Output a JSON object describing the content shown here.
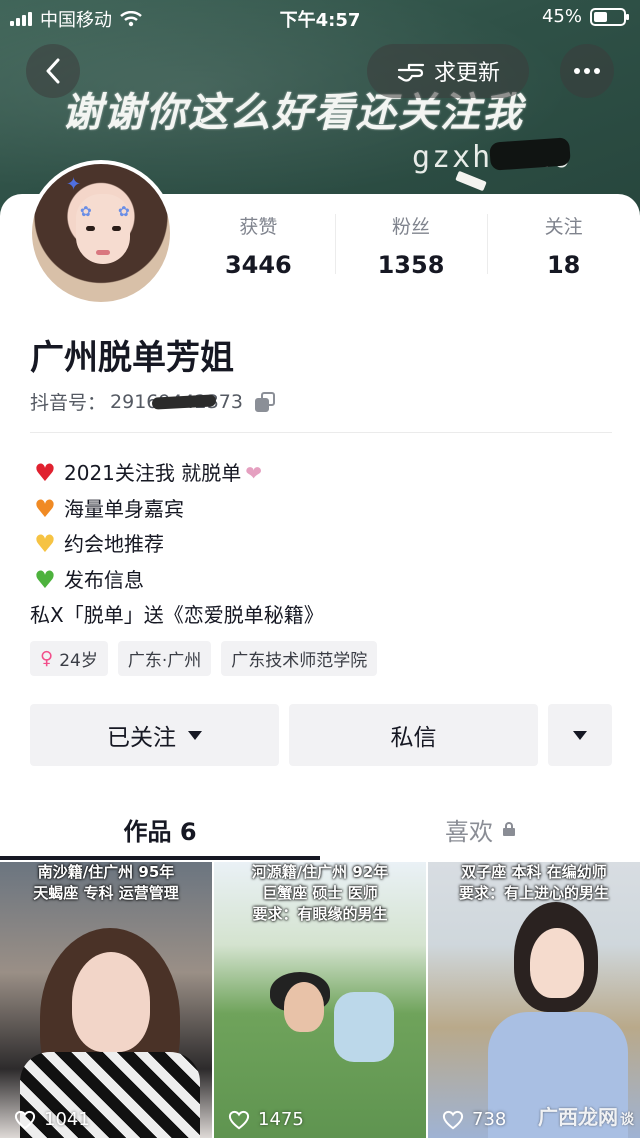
{
  "status_bar": {
    "carrier": "中国移动",
    "time": "下午4:57",
    "battery": "45%",
    "battery_level": 0.45
  },
  "header": {
    "request_update_label": "求更新"
  },
  "banner": {
    "chalk_text": "谢谢你这么好看还关注我",
    "chalk_id": "gzxh      520"
  },
  "profile": {
    "stats": [
      {
        "label": "获赞",
        "value": "3446"
      },
      {
        "label": "粉丝",
        "value": "1358"
      },
      {
        "label": "关注",
        "value": "18"
      }
    ],
    "name": "广州脱单芳姐",
    "douyin_label": "抖音号：",
    "douyin_id": "29169442373",
    "bio": [
      {
        "icon": "red-heart",
        "color": "#e0212f",
        "text": "2021关注我 就脱单"
      },
      {
        "icon": "orange-heart",
        "color": "#f08a24",
        "text": "海量单身嘉宾"
      },
      {
        "icon": "yellow-heart",
        "color": "#f6c343",
        "text": "约会地推荐"
      },
      {
        "icon": "green-heart",
        "color": "#4db23d",
        "text": "发布信息"
      },
      {
        "icon": "",
        "color": "",
        "text": "私X「脱单」送《恋爱脱单秘籍》"
      }
    ],
    "tags": {
      "age": "24岁",
      "location": "广东·广州",
      "school": "广东技术师范学院"
    }
  },
  "actions": {
    "followed_label": "已关注",
    "message_label": "私信"
  },
  "tabs": {
    "works": "作品 6",
    "likes": "喜欢"
  },
  "videos": [
    {
      "caption_1": "南沙籍/住广州 95年",
      "caption_2": "天蝎座 专科 运营管理",
      "likes": "1041"
    },
    {
      "caption_1": "河源籍/住广州 92年",
      "caption_2": "巨蟹座 硕士 医师",
      "caption_3": "要求：有眼缘的男生",
      "likes": "1475"
    },
    {
      "caption_1": "双子座 本科 在编幼师",
      "caption_2": "要求：有上进心的男生",
      "likes": "738"
    }
  ],
  "watermark": {
    "text": "广西龙网",
    "sub": "谈"
  },
  "colors": {
    "accent_pink": "#f24e8a",
    "text_primary": "#161823",
    "text_secondary": "#80848e"
  }
}
